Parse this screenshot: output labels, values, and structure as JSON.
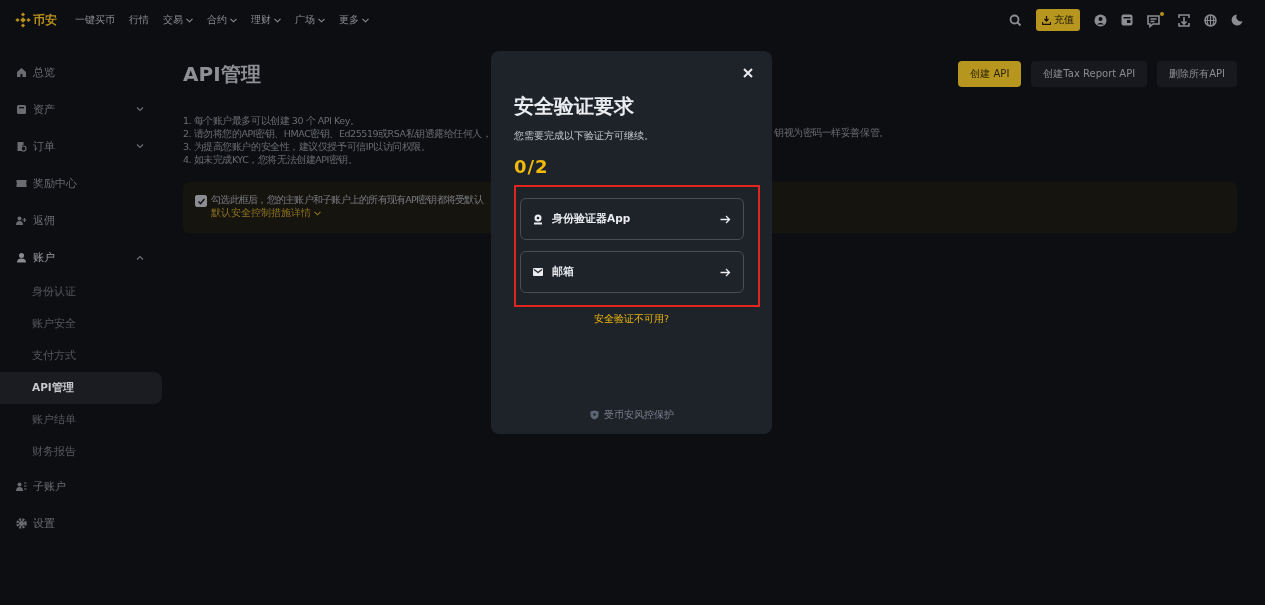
{
  "topbar": {
    "logo": "币安",
    "nav": [
      {
        "label": "一键买币",
        "dropdown": false
      },
      {
        "label": "行情",
        "dropdown": false
      },
      {
        "label": "交易",
        "dropdown": true
      },
      {
        "label": "合约",
        "dropdown": true
      },
      {
        "label": "理财",
        "dropdown": true
      },
      {
        "label": "广场",
        "dropdown": true
      },
      {
        "label": "更多",
        "dropdown": true
      }
    ],
    "deposit_button": "充值",
    "messages_unread": true
  },
  "sidebar": {
    "items": [
      {
        "label": "总览"
      },
      {
        "label": "资产",
        "expanded": false
      },
      {
        "label": "订单",
        "expanded": false
      },
      {
        "label": "奖励中心"
      },
      {
        "label": "返佣"
      },
      {
        "label": "账户",
        "expanded": true,
        "children": [
          {
            "label": "身份认证",
            "selected": false
          },
          {
            "label": "账户安全",
            "selected": false
          },
          {
            "label": "支付方式",
            "selected": false
          },
          {
            "label": "API管理",
            "selected": true
          },
          {
            "label": "账户结单",
            "selected": false
          },
          {
            "label": "财务报告",
            "selected": false
          }
        ]
      },
      {
        "label": "子账户"
      },
      {
        "label": "设置"
      }
    ]
  },
  "page": {
    "title": "API管理",
    "buttons": [
      {
        "label": "创建 API",
        "kind": "primary"
      },
      {
        "label": "创建Tax Report API",
        "kind": "secondary"
      },
      {
        "label": "删除所有API",
        "kind": "secondary"
      }
    ],
    "notes": [
      "1. 每个账户最多可以创建 30 个 API Key。",
      "2. 请勿将您的API密钥、HMAC密钥、Ed25519或RSA私钥透露给任何人，",
      "3. 为提高您账户的安全性，建议仅授予可信IP以访问权限。",
      "4. 如未完成KYC，您将无法创建API密钥。"
    ],
    "note_2_tail": "钥视为密码一样妥善保管。",
    "default_security": {
      "checked": true,
      "text": "勾选此框后，您的主账户和子账户上的所有现有API密钥都将受默认",
      "details_link": "默认安全控制措施详情"
    }
  },
  "modal": {
    "title": "安全验证要求",
    "subtitle": "您需要完成以下验证方可继续。",
    "progress": "0/2",
    "options_highlighted": true,
    "options": [
      {
        "label": "身份验证器App",
        "kind": "authenticator"
      },
      {
        "label": "邮箱",
        "kind": "email"
      }
    ],
    "unavailable_link": "安全验证不可用?",
    "footer": "受币安风控保护"
  }
}
